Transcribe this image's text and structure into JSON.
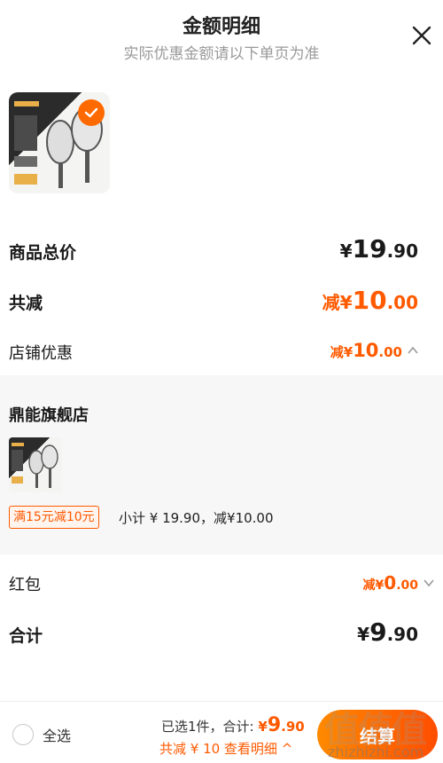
{
  "header": {
    "title": "金额明细",
    "subtitle": "实际优惠金额请以下单页为准"
  },
  "product": {
    "thumb_badge_color": "#ff6a00"
  },
  "rows": {
    "total_label": "商品总价",
    "total_yen": "¥",
    "total_int": "19",
    "total_dec": ".90",
    "reduce_label": "共减",
    "reduce_prefix": "减¥",
    "reduce_int": "10",
    "reduce_dec": ".00",
    "store_label": "店铺优惠",
    "store_prefix": "减¥",
    "store_int": "10",
    "store_dec": ".00",
    "redpack_label": "红包",
    "redpack_prefix": "减¥",
    "redpack_int": "0",
    "redpack_dec": ".00",
    "sum_label": "合计",
    "sum_yen": "¥",
    "sum_int": "9",
    "sum_dec": ".90"
  },
  "store": {
    "name": "鼎能旗舰店",
    "promo_tag": "满15元减10元",
    "subtotal_text": "小计 ¥ 19.90，减¥10.00"
  },
  "bottom": {
    "select_all": "全选",
    "selected_prefix": "已选1件，合计: ",
    "selected_yen": "¥",
    "selected_int": "9",
    "selected_dec": ".90",
    "reduce_detail": "共减 ¥ 10  查看明细 ^",
    "checkout": "结算"
  },
  "watermark": {
    "mark": "值值值",
    "url": "zhizhizhi.com"
  },
  "colors": {
    "accent": "#ff5a00",
    "checkout_from": "#ff8a00",
    "checkout_to": "#ff4d00"
  },
  "icons": [
    "close-icon",
    "check-icon",
    "chevron-up-icon",
    "chevron-down-icon",
    "radio-icon"
  ]
}
